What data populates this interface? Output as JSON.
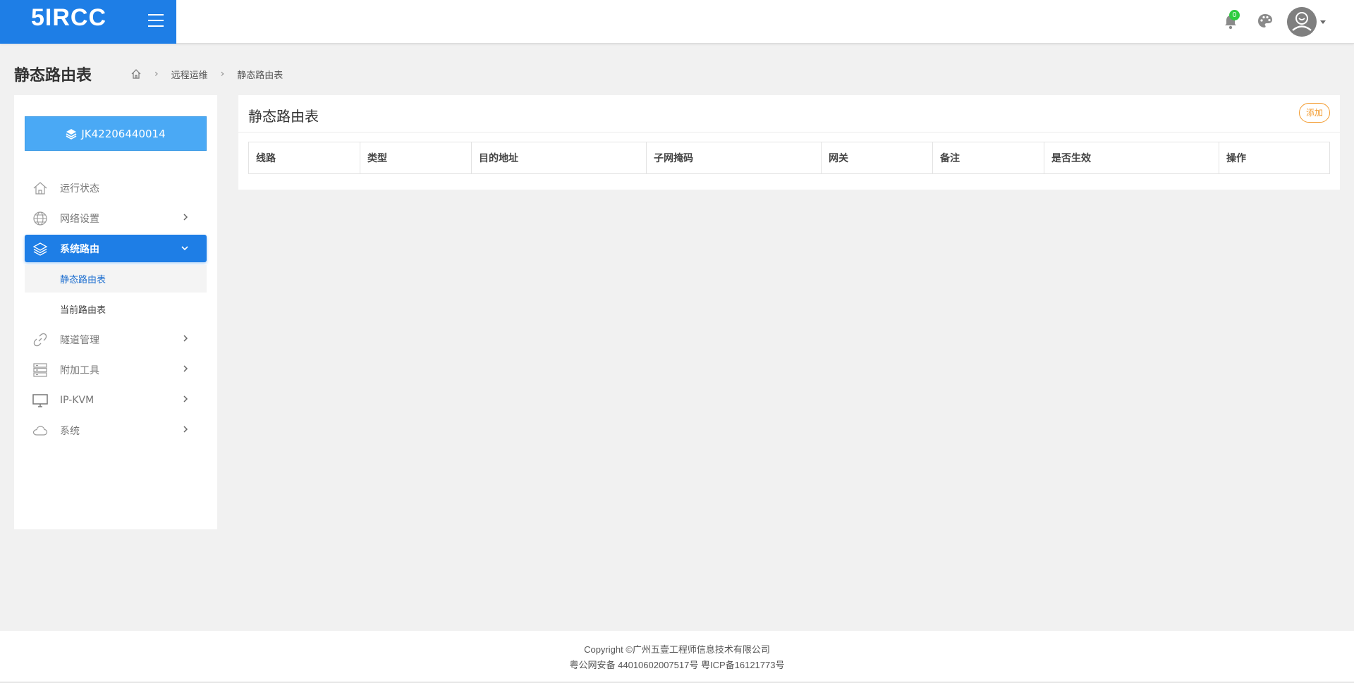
{
  "header": {
    "logo_text": "5IRCC",
    "notification_count": "0",
    "colors": {
      "brand": "#1e7ee6",
      "badge": "#2ecc40"
    }
  },
  "page": {
    "title": "静态路由表",
    "breadcrumb": [
      "远程运维",
      "静态路由表"
    ]
  },
  "sidebar": {
    "device_id": "JK42206440014",
    "items": [
      {
        "label": "运行状态",
        "icon": "home-icon",
        "has_arrow": false
      },
      {
        "label": "网络设置",
        "icon": "globe-icon",
        "has_arrow": true
      },
      {
        "label": "系统路由",
        "icon": "layers-icon",
        "has_arrow": true,
        "active": true,
        "children": [
          {
            "label": "静态路由表",
            "current": true
          },
          {
            "label": "当前路由表"
          }
        ]
      },
      {
        "label": "隧道管理",
        "icon": "link-icon",
        "has_arrow": true
      },
      {
        "label": "附加工具",
        "icon": "server-icon",
        "has_arrow": true
      },
      {
        "label": "IP-KVM",
        "icon": "monitor-icon",
        "has_arrow": true
      },
      {
        "label": "系统",
        "icon": "cloud-icon",
        "has_arrow": true
      }
    ]
  },
  "main": {
    "card_title": "静态路由表",
    "add_label": "添加",
    "columns": [
      "线路",
      "类型",
      "目的地址",
      "子网掩码",
      "网关",
      "备注",
      "是否生效",
      "操作"
    ],
    "rows": []
  },
  "footer": {
    "copyright": "Copyright ©广州五壹工程师信息技术有限公司",
    "icp": "粤公网安备 44010602007517号 粤ICP备16121773号"
  }
}
